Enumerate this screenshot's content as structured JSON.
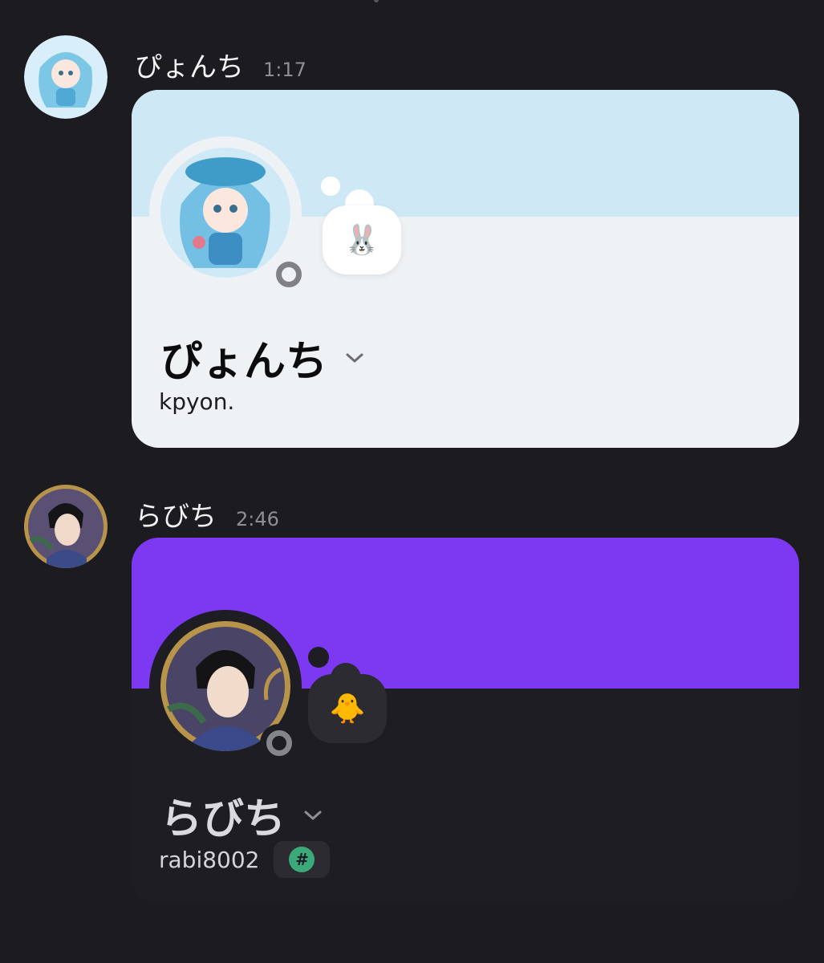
{
  "messages": [
    {
      "author": "ぴょんち",
      "time": "1:17",
      "card": {
        "display_name": "ぴょんち",
        "username": "kpyon.",
        "status_emoji": "🐰",
        "colors": {
          "banner": "#cfe8f6",
          "body": "#eef2f4"
        }
      }
    },
    {
      "author": "らびち",
      "time": "2:46",
      "card": {
        "display_name": "らびち",
        "username": "rabi8002",
        "status_emoji": "🐥",
        "badge_icon": "#",
        "colors": {
          "banner": "#7d39f1",
          "body": "#1d1d23",
          "badge": "#3ba97a"
        }
      }
    }
  ],
  "icons": {
    "chevron": "chevron-down-icon",
    "status": "status-offline-icon"
  },
  "theme": {
    "background": "#1b1b20"
  }
}
